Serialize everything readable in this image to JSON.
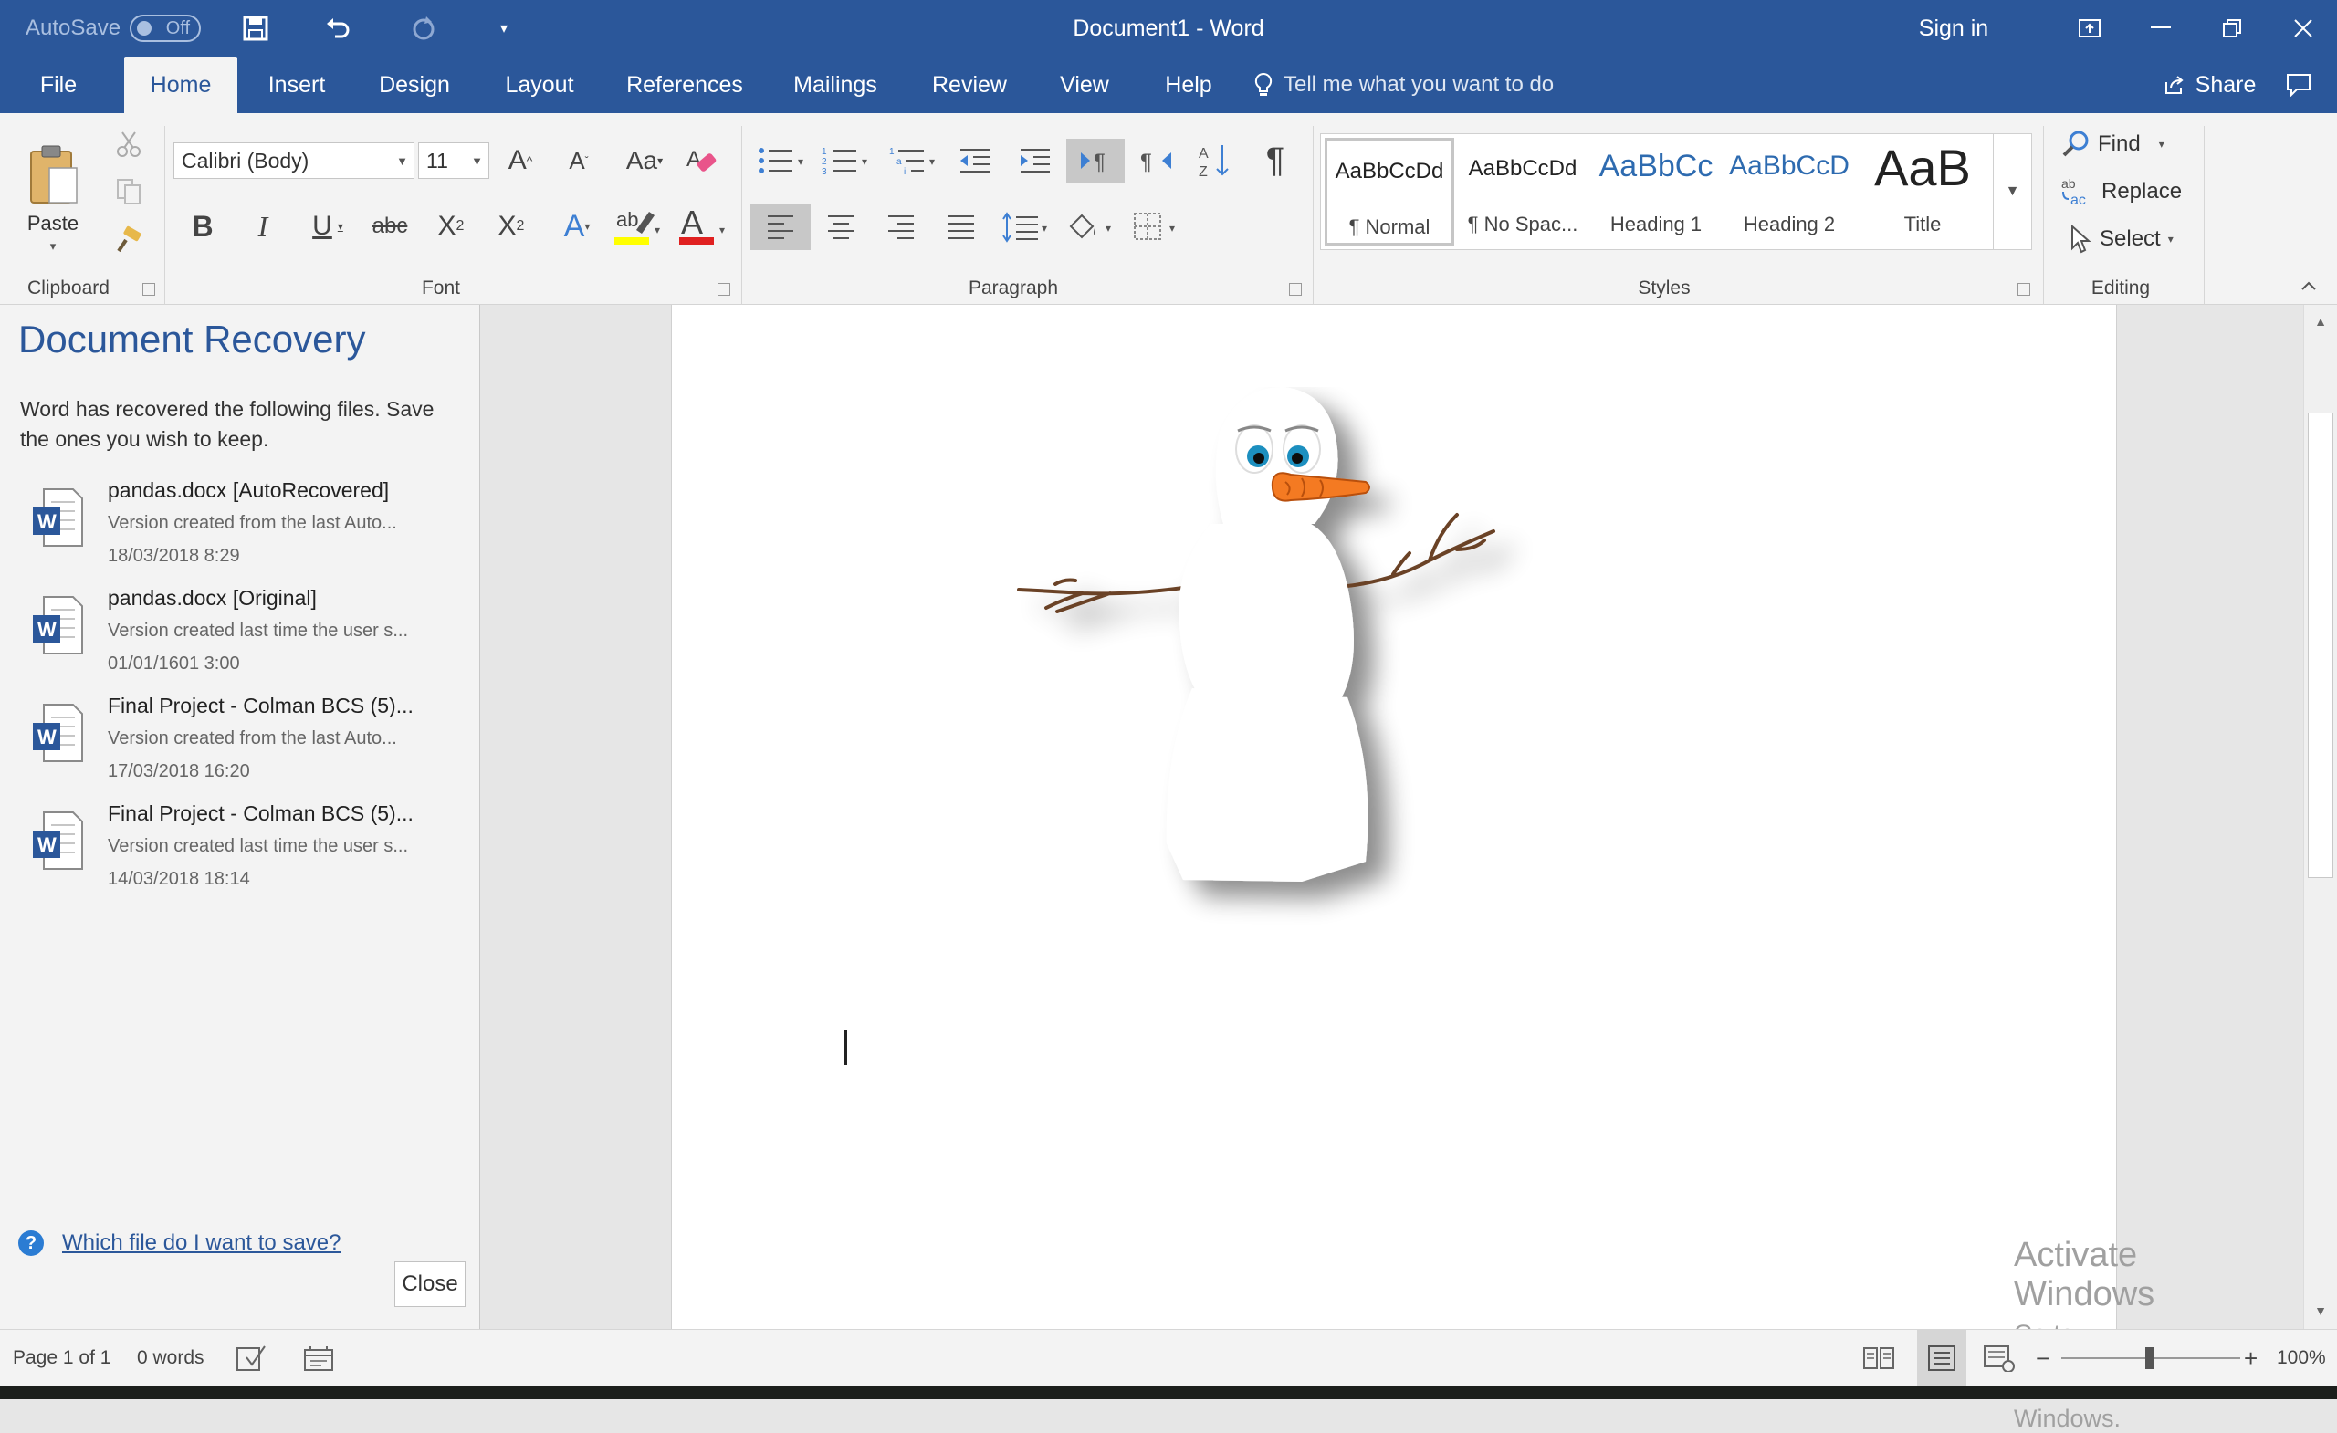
{
  "titlebar": {
    "autosave_label": "AutoSave",
    "autosave_state": "Off",
    "doc_title": "Document1  -  Word",
    "sign_in": "Sign in"
  },
  "tabs": [
    "File",
    "Home",
    "Insert",
    "Design",
    "Layout",
    "References",
    "Mailings",
    "Review",
    "View",
    "Help"
  ],
  "active_tab": "Home",
  "tell_me": "Tell me what you want to do",
  "share": "Share",
  "ribbon": {
    "clipboard": {
      "label": "Clipboard",
      "paste": "Paste"
    },
    "font": {
      "label": "Font",
      "family": "Calibri (Body)",
      "size": "11"
    },
    "paragraph": {
      "label": "Paragraph"
    },
    "styles": {
      "label": "Styles",
      "items": [
        {
          "sample": "AaBbCcDd",
          "name": "¶ Normal"
        },
        {
          "sample": "AaBbCcDd",
          "name": "¶ No Spac..."
        },
        {
          "sample": "AaBbCc",
          "name": "Heading 1"
        },
        {
          "sample": "AaBbCcD",
          "name": "Heading 2"
        },
        {
          "sample": "AaB",
          "name": "Title"
        }
      ]
    },
    "editing": {
      "label": "Editing",
      "find": "Find",
      "replace": "Replace",
      "select": "Select"
    }
  },
  "recovery": {
    "title": "Document Recovery",
    "description": "Word has recovered the following files.  Save the ones you wish to keep.",
    "files": [
      {
        "name": "pandas.docx  [AutoRecovered]",
        "version": "Version created from the last Auto...",
        "date": "18/03/2018 8:29"
      },
      {
        "name": "pandas.docx  [Original]",
        "version": "Version created last time the user s...",
        "date": "01/01/1601 3:00"
      },
      {
        "name": "Final Project - Colman BCS (5)...",
        "version": "Version created from the last Auto...",
        "date": "17/03/2018 16:20"
      },
      {
        "name": "Final Project - Colman BCS (5)...",
        "version": "Version created last time the user s...",
        "date": "14/03/2018 18:14"
      }
    ],
    "help_link": "Which file do I want to save?",
    "close": "Close"
  },
  "watermark": {
    "line1": "Activate Windows",
    "line2": "Go to Settings to activate Windows."
  },
  "status": {
    "page": "Page 1 of 1",
    "words": "0 words",
    "zoom": "100%"
  },
  "colors": {
    "brand": "#2b579a",
    "ribbon_bg": "#f3f3f3",
    "canvas_bg": "#e6e6e6"
  }
}
